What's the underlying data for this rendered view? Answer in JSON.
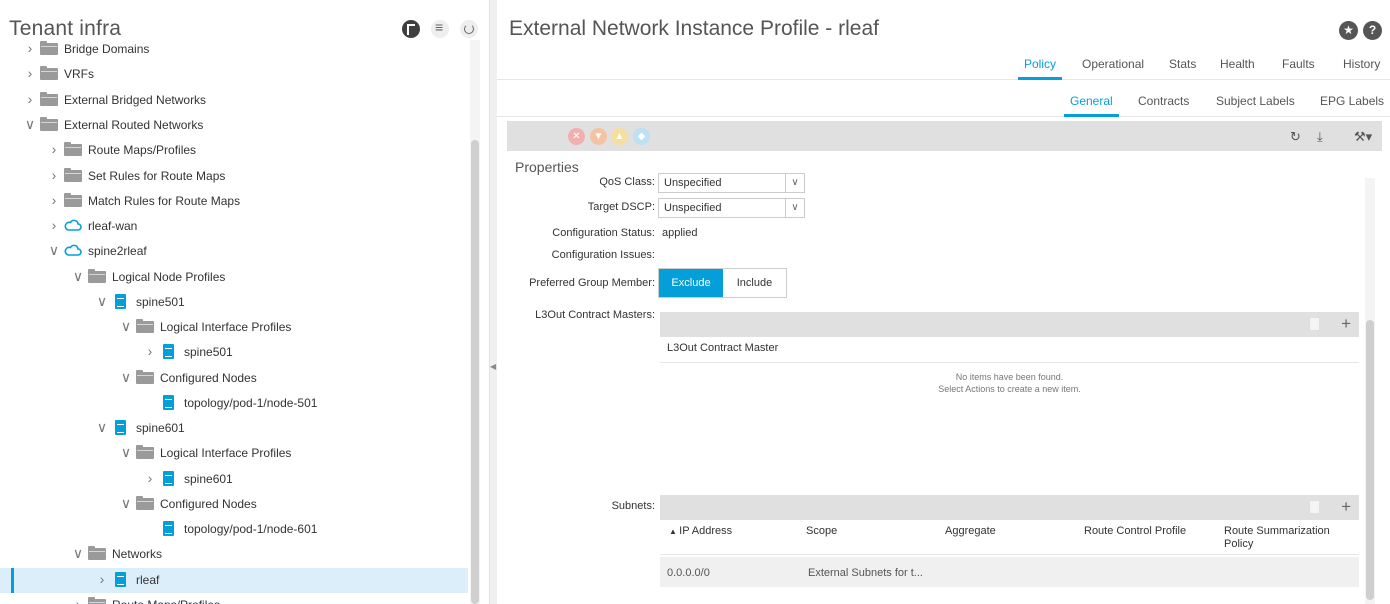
{
  "left_panel": {
    "title": "Tenant infra",
    "header_icons": [
      "policy-usage-icon",
      "filter-icon",
      "refresh-icon"
    ],
    "tree": [
      {
        "label": "Bridge Domains",
        "icon": "folder-icon",
        "expander": "collapsed"
      },
      {
        "label": "VRFs",
        "icon": "folder-icon",
        "expander": "collapsed"
      },
      {
        "label": "External Bridged Networks",
        "icon": "folder-icon",
        "expander": "collapsed"
      },
      {
        "label": "External Routed Networks",
        "icon": "folder-icon",
        "expander": "expanded"
      },
      {
        "label": "Route Maps/Profiles",
        "icon": "folder-icon",
        "expander": "collapsed"
      },
      {
        "label": "Set Rules for Route Maps",
        "icon": "folder-icon",
        "expander": "collapsed"
      },
      {
        "label": "Match Rules for Route Maps",
        "icon": "folder-icon",
        "expander": "collapsed"
      },
      {
        "label": "rleaf-wan",
        "icon": "cloud-icon",
        "expander": "collapsed"
      },
      {
        "label": "spine2rleaf",
        "icon": "cloud-icon",
        "expander": "expanded"
      },
      {
        "label": "Logical Node Profiles",
        "icon": "folder-icon",
        "expander": "expanded"
      },
      {
        "label": "spine501",
        "icon": "document-icon",
        "expander": "expanded"
      },
      {
        "label": "Logical Interface Profiles",
        "icon": "folder-icon",
        "expander": "expanded"
      },
      {
        "label": "spine501",
        "icon": "document-icon",
        "expander": "collapsed"
      },
      {
        "label": "Configured Nodes",
        "icon": "folder-icon",
        "expander": "expanded"
      },
      {
        "label": "topology/pod-1/node-501",
        "icon": "document-icon",
        "expander": "none"
      },
      {
        "label": "spine601",
        "icon": "document-icon",
        "expander": "expanded"
      },
      {
        "label": "Logical Interface Profiles",
        "icon": "folder-icon",
        "expander": "expanded"
      },
      {
        "label": "spine601",
        "icon": "document-icon",
        "expander": "collapsed"
      },
      {
        "label": "Configured Nodes",
        "icon": "folder-icon",
        "expander": "expanded"
      },
      {
        "label": "topology/pod-1/node-601",
        "icon": "document-icon",
        "expander": "none"
      },
      {
        "label": "Networks",
        "icon": "folder-icon",
        "expander": "expanded"
      },
      {
        "label": "rleaf",
        "icon": "document-icon",
        "expander": "collapsed",
        "selected": true
      },
      {
        "label": "Route Maps/Profiles",
        "icon": "folder-icon",
        "expander": "collapsed"
      }
    ]
  },
  "header": {
    "title": "External Network Instance Profile - rleaf",
    "buttons": [
      {
        "icon": "star-icon"
      },
      {
        "icon": "help-icon",
        "glyph": "?"
      }
    ]
  },
  "tabs_primary": [
    "Policy",
    "Operational",
    "Stats",
    "Health",
    "Faults",
    "History"
  ],
  "tabs_primary_active": "Policy",
  "tabs_secondary": [
    "General",
    "Contracts",
    "Subject Labels",
    "EPG Labels"
  ],
  "tabs_secondary_active": "General",
  "toolbar": {
    "fault_icons": [
      "critical-fault-icon",
      "major-fault-icon",
      "minor-fault-icon",
      "warning-fault-icon"
    ],
    "actions": [
      "refresh-icon",
      "download-icon",
      "tools-icon"
    ]
  },
  "properties": {
    "title": "Properties",
    "qos_class": {
      "label": "QoS Class:",
      "value": "Unspecified"
    },
    "target_dscp": {
      "label": "Target DSCP:",
      "value": "Unspecified"
    },
    "config_status": {
      "label": "Configuration Status:",
      "value": "applied"
    },
    "config_issues": {
      "label": "Configuration Issues:",
      "value": ""
    },
    "preferred_group": {
      "label": "Preferred Group Member:",
      "options": [
        "Exclude",
        "Include"
      ],
      "selected": "Exclude"
    },
    "l3out_masters": {
      "label": "L3Out Contract Masters:",
      "column": "L3Out Contract Master",
      "empty_line1": "No items have been found.",
      "empty_line2": "Select Actions to create a new item."
    },
    "subnets": {
      "label": "Subnets:",
      "columns": [
        "IP Address",
        "Scope",
        "Aggregate",
        "Route Control Profile",
        "Route Summarization Policy"
      ],
      "rows": [
        {
          "ip": "0.0.0.0/0",
          "scope": "External Subnets for t...",
          "aggregate": "",
          "route_control_profile": "",
          "route_summarization_policy": ""
        }
      ]
    }
  },
  "colors": {
    "accent": "#049fd9"
  }
}
